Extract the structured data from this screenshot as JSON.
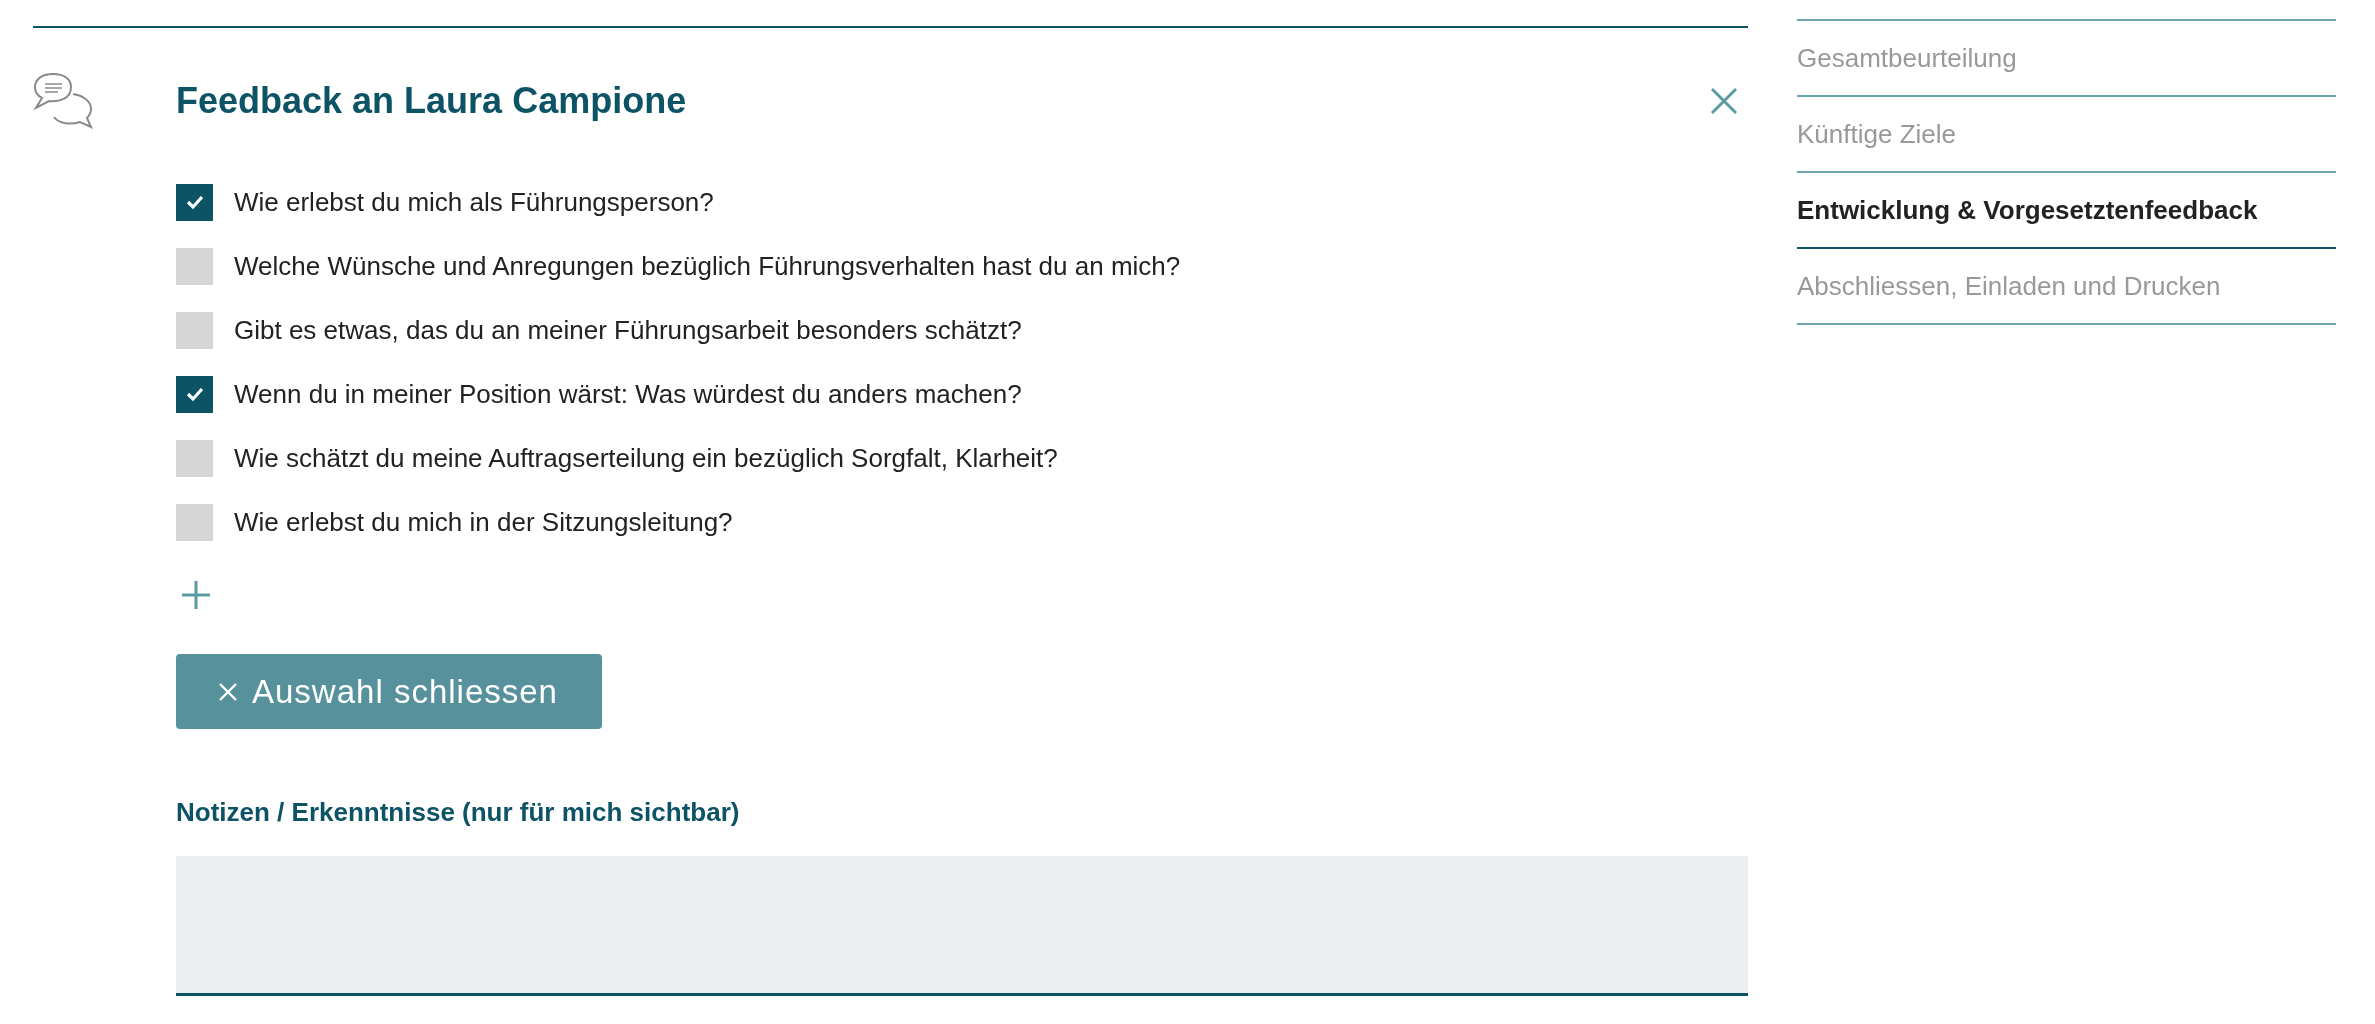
{
  "panel": {
    "title": "Feedback an Laura Campione",
    "questions": [
      {
        "label": "Wie erlebst du mich als Führungsperson?",
        "checked": true
      },
      {
        "label": "Welche Wünsche und Anregungen bezüglich Führungsverhalten hast du an mich?",
        "checked": false
      },
      {
        "label": "Gibt es etwas, das du an meiner Führungsarbeit besonders schätzt?",
        "checked": false
      },
      {
        "label": "Wenn du in meiner Position wärst: Was würdest du anders machen?",
        "checked": true
      },
      {
        "label": "Wie schätzt du meine Auftragserteilung ein bezüglich Sorgfalt, Klarheit?",
        "checked": false
      },
      {
        "label": "Wie erlebst du mich in der Sitzungsleitung?",
        "checked": false
      }
    ],
    "close_selection_button": "Auswahl schliessen",
    "notes_label": "Notizen / Erkenntnisse (nur für mich sichtbar)"
  },
  "sidebar": {
    "items": [
      {
        "label": "Gesamtbeurteilung",
        "selected": false
      },
      {
        "label": "Künftige Ziele",
        "selected": false
      },
      {
        "label": "Entwicklung & Vorgesetztenfeedback",
        "selected": true
      },
      {
        "label": "Abschliessen, Einladen und Drucken",
        "selected": false
      }
    ]
  }
}
